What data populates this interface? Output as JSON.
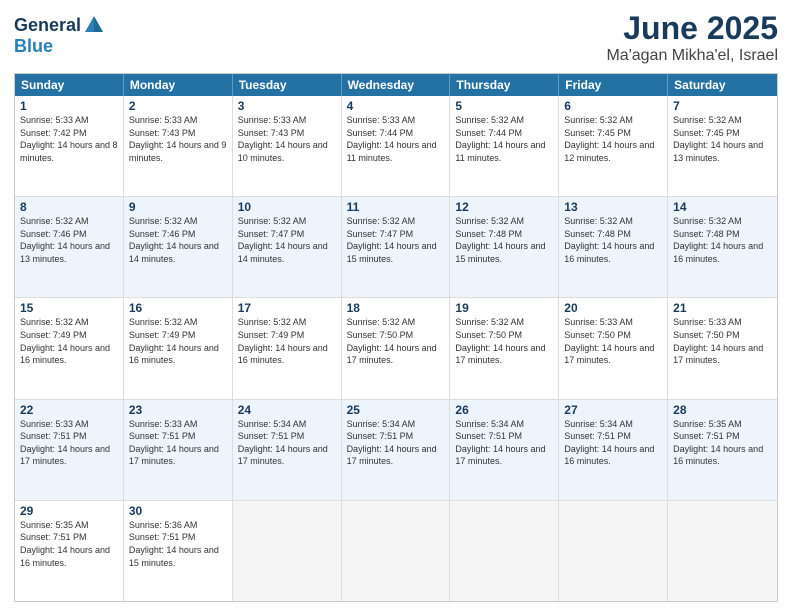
{
  "logo": {
    "general": "General",
    "blue": "Blue"
  },
  "title": "June 2025",
  "location": "Ma'agan Mikha'el, Israel",
  "days_of_week": [
    "Sunday",
    "Monday",
    "Tuesday",
    "Wednesday",
    "Thursday",
    "Friday",
    "Saturday"
  ],
  "weeks": [
    [
      {
        "day": 1,
        "sunrise": "5:33 AM",
        "sunset": "7:42 PM",
        "daylight": "14 hours and 8 minutes."
      },
      {
        "day": 2,
        "sunrise": "5:33 AM",
        "sunset": "7:43 PM",
        "daylight": "14 hours and 9 minutes."
      },
      {
        "day": 3,
        "sunrise": "5:33 AM",
        "sunset": "7:43 PM",
        "daylight": "14 hours and 10 minutes."
      },
      {
        "day": 4,
        "sunrise": "5:33 AM",
        "sunset": "7:44 PM",
        "daylight": "14 hours and 11 minutes."
      },
      {
        "day": 5,
        "sunrise": "5:32 AM",
        "sunset": "7:44 PM",
        "daylight": "14 hours and 11 minutes."
      },
      {
        "day": 6,
        "sunrise": "5:32 AM",
        "sunset": "7:45 PM",
        "daylight": "14 hours and 12 minutes."
      },
      {
        "day": 7,
        "sunrise": "5:32 AM",
        "sunset": "7:45 PM",
        "daylight": "14 hours and 13 minutes."
      }
    ],
    [
      {
        "day": 8,
        "sunrise": "5:32 AM",
        "sunset": "7:46 PM",
        "daylight": "14 hours and 13 minutes."
      },
      {
        "day": 9,
        "sunrise": "5:32 AM",
        "sunset": "7:46 PM",
        "daylight": "14 hours and 14 minutes."
      },
      {
        "day": 10,
        "sunrise": "5:32 AM",
        "sunset": "7:47 PM",
        "daylight": "14 hours and 14 minutes."
      },
      {
        "day": 11,
        "sunrise": "5:32 AM",
        "sunset": "7:47 PM",
        "daylight": "14 hours and 15 minutes."
      },
      {
        "day": 12,
        "sunrise": "5:32 AM",
        "sunset": "7:48 PM",
        "daylight": "14 hours and 15 minutes."
      },
      {
        "day": 13,
        "sunrise": "5:32 AM",
        "sunset": "7:48 PM",
        "daylight": "14 hours and 16 minutes."
      },
      {
        "day": 14,
        "sunrise": "5:32 AM",
        "sunset": "7:48 PM",
        "daylight": "14 hours and 16 minutes."
      }
    ],
    [
      {
        "day": 15,
        "sunrise": "5:32 AM",
        "sunset": "7:49 PM",
        "daylight": "14 hours and 16 minutes."
      },
      {
        "day": 16,
        "sunrise": "5:32 AM",
        "sunset": "7:49 PM",
        "daylight": "14 hours and 16 minutes."
      },
      {
        "day": 17,
        "sunrise": "5:32 AM",
        "sunset": "7:49 PM",
        "daylight": "14 hours and 16 minutes."
      },
      {
        "day": 18,
        "sunrise": "5:32 AM",
        "sunset": "7:50 PM",
        "daylight": "14 hours and 17 minutes."
      },
      {
        "day": 19,
        "sunrise": "5:32 AM",
        "sunset": "7:50 PM",
        "daylight": "14 hours and 17 minutes."
      },
      {
        "day": 20,
        "sunrise": "5:33 AM",
        "sunset": "7:50 PM",
        "daylight": "14 hours and 17 minutes."
      },
      {
        "day": 21,
        "sunrise": "5:33 AM",
        "sunset": "7:50 PM",
        "daylight": "14 hours and 17 minutes."
      }
    ],
    [
      {
        "day": 22,
        "sunrise": "5:33 AM",
        "sunset": "7:51 PM",
        "daylight": "14 hours and 17 minutes."
      },
      {
        "day": 23,
        "sunrise": "5:33 AM",
        "sunset": "7:51 PM",
        "daylight": "14 hours and 17 minutes."
      },
      {
        "day": 24,
        "sunrise": "5:34 AM",
        "sunset": "7:51 PM",
        "daylight": "14 hours and 17 minutes."
      },
      {
        "day": 25,
        "sunrise": "5:34 AM",
        "sunset": "7:51 PM",
        "daylight": "14 hours and 17 minutes."
      },
      {
        "day": 26,
        "sunrise": "5:34 AM",
        "sunset": "7:51 PM",
        "daylight": "14 hours and 17 minutes."
      },
      {
        "day": 27,
        "sunrise": "5:34 AM",
        "sunset": "7:51 PM",
        "daylight": "14 hours and 16 minutes."
      },
      {
        "day": 28,
        "sunrise": "5:35 AM",
        "sunset": "7:51 PM",
        "daylight": "14 hours and 16 minutes."
      }
    ],
    [
      {
        "day": 29,
        "sunrise": "5:35 AM",
        "sunset": "7:51 PM",
        "daylight": "14 hours and 16 minutes."
      },
      {
        "day": 30,
        "sunrise": "5:36 AM",
        "sunset": "7:51 PM",
        "daylight": "14 hours and 15 minutes."
      },
      null,
      null,
      null,
      null,
      null
    ]
  ]
}
